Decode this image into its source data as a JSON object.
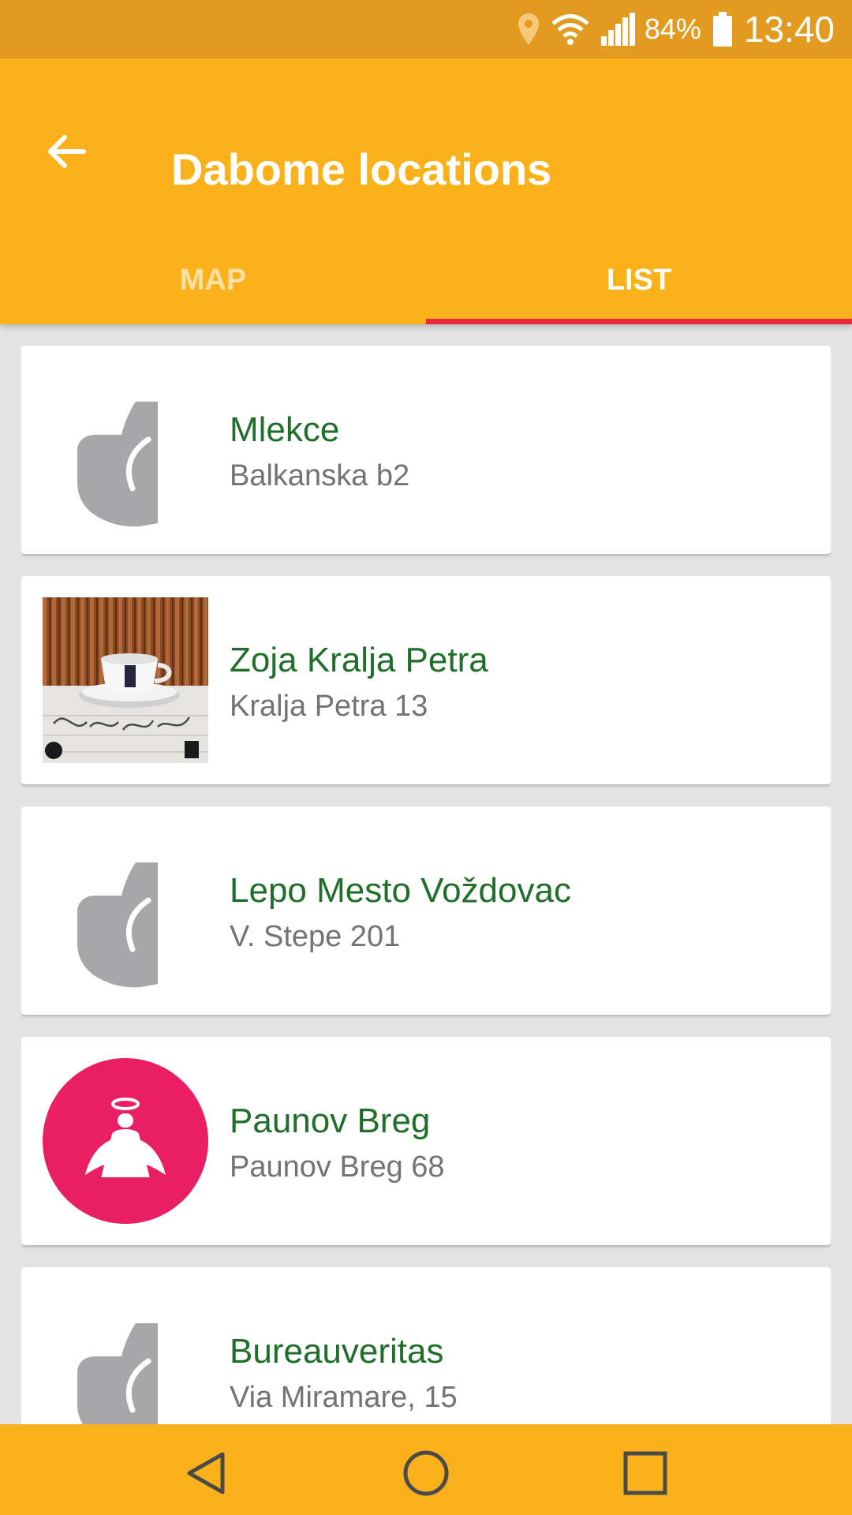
{
  "status_bar": {
    "battery": "84%",
    "time": "13:40",
    "icons": [
      "location-icon",
      "wifi-icon",
      "signal-icon",
      "battery-icon"
    ]
  },
  "app_bar": {
    "title": "Dabome locations",
    "back_icon": "arrow-back-icon",
    "tabs": [
      {
        "label": "MAP",
        "selected": false
      },
      {
        "label": "LIST",
        "selected": true
      }
    ]
  },
  "locations": [
    {
      "name": "Mlekce",
      "address": "Balkanska b2",
      "image": "thumbs-up-placeholder-icon"
    },
    {
      "name": "Zoja Kralja Petra",
      "address": "Kralja Petra 13",
      "image": "coffee-cup-photo"
    },
    {
      "name": "Lepo Mesto Voždovac",
      "address": "V. Stepe 201",
      "image": "thumbs-up-placeholder-icon"
    },
    {
      "name": "Paunov Breg",
      "address": "Paunov Breg 68",
      "image": "angel-logo"
    },
    {
      "name": "Bureauveritas",
      "address": "Via Miramare, 15",
      "image": "thumbs-up-placeholder-icon"
    }
  ],
  "nav_bar": {
    "buttons": [
      "back-triangle-icon",
      "home-circle-icon",
      "recents-square-icon"
    ]
  },
  "colors": {
    "status_bar": "#e29a21",
    "app_bar": "#fbb11a",
    "tab_indicator": "#e8283f",
    "name_text": "#1f6e2a",
    "address_text": "#737373",
    "angel_logo": "#e91e63"
  }
}
